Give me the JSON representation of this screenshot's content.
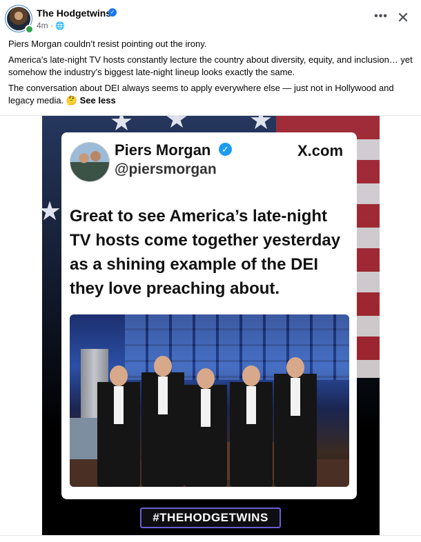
{
  "post": {
    "author": "The Hodgetwins",
    "time": "4m",
    "paragraphs": [
      "Piers Morgan couldn’t resist pointing out the irony.",
      "America’s late-night TV hosts constantly lecture the country about diversity, equity, and inclusion… yet somehow the industry’s biggest late-night lineup looks exactly the same.",
      "The conversation about DEI always seems to apply everywhere else — just not in Hollywood and legacy media. 🤔"
    ],
    "see_less": "See less"
  },
  "icons": {
    "verified": "verified-badge-icon",
    "privacy": "globe-icon",
    "more": "more-options-icon",
    "close": "close-icon"
  },
  "media": {
    "card": {
      "name": "Piers Morgan",
      "handle": "@piersmorgan",
      "site": "X.com",
      "quote": "Great to see America’s late-night TV hosts come together yesterday as a shining example of the DEI they love preaching about."
    },
    "hashtag": "#THEHODGETWINS"
  },
  "colors": {
    "facebook_blue": "#1877f2",
    "x_verified": "#1d9bf0",
    "online_green": "#31a24c"
  }
}
